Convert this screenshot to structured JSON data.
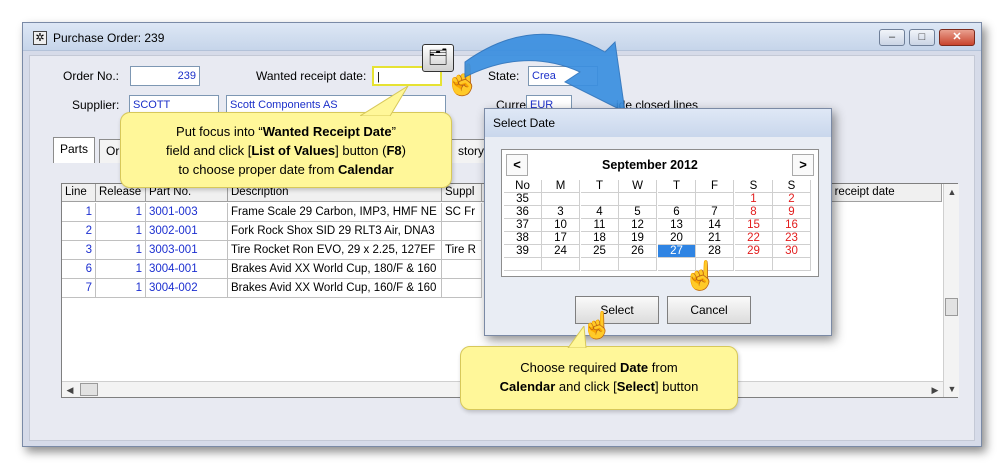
{
  "window": {
    "title": "Purchase Order: 239",
    "min_label": "–",
    "max_label": "□",
    "close_label": "✕"
  },
  "form": {
    "order_no_label": "Order No.:",
    "order_no_value": "239",
    "wanted_receipt_label": "Wanted receipt date:",
    "wanted_receipt_value": "|",
    "state_label": "State:",
    "state_value": "Crea",
    "supplier_label": "Supplier:",
    "supplier_code": "SCOTT",
    "supplier_name": "Scott Components AS",
    "currency_label": "Currency:",
    "currency_value": "EUR",
    "hide_closed_label": "ide closed lines"
  },
  "tabs": [
    "Parts",
    "Or",
    "story"
  ],
  "grid": {
    "headers": [
      "Line",
      "Release",
      "Part No.",
      "Description",
      "Suppl",
      "d receipt date"
    ],
    "rows": [
      {
        "line": "1",
        "release": "1",
        "part": "3001-003",
        "desc": "Frame Scale 29 Carbon, IMP3, HMF NE",
        "supp": "SC Fr"
      },
      {
        "line": "2",
        "release": "1",
        "part": "3002-001",
        "desc": "Fork Rock Shox SID 29 RLT3 Air, DNA3",
        "supp": ""
      },
      {
        "line": "3",
        "release": "1",
        "part": "3003-001",
        "desc": "Tire Rocket Ron EVO, 29 x 2.25, 127EF",
        "supp": "Tire R"
      },
      {
        "line": "6",
        "release": "1",
        "part": "3004-001",
        "desc": "Brakes Avid XX World Cup, 180/F & 160",
        "supp": ""
      },
      {
        "line": "7",
        "release": "1",
        "part": "3004-002",
        "desc": "Brakes Avid XX World Cup, 160/F & 160",
        "supp": ""
      }
    ]
  },
  "dialog": {
    "title": "Select Date",
    "month": "September 2012",
    "prev": "<",
    "next": ">",
    "day_headers": [
      "No",
      "M",
      "T",
      "W",
      "T",
      "F",
      "S",
      "S"
    ],
    "weeks": [
      {
        "no": "35",
        "days": [
          "",
          "",
          "",
          "",
          "",
          "1",
          "2"
        ]
      },
      {
        "no": "36",
        "days": [
          "3",
          "4",
          "5",
          "6",
          "7",
          "8",
          "9"
        ]
      },
      {
        "no": "37",
        "days": [
          "10",
          "11",
          "12",
          "13",
          "14",
          "15",
          "16"
        ]
      },
      {
        "no": "38",
        "days": [
          "17",
          "18",
          "19",
          "20",
          "21",
          "22",
          "23"
        ]
      },
      {
        "no": "39",
        "days": [
          "24",
          "25",
          "26",
          "27",
          "28",
          "29",
          "30"
        ]
      }
    ],
    "selected_day": "27",
    "select_label": "Select",
    "cancel_label": "Cancel"
  },
  "callouts": {
    "top": {
      "line1_a": "Put focus into “",
      "line1_b": "Wanted Receipt Date",
      "line1_c": "”",
      "line2_a": "field and click [",
      "line2_b": "List of Values",
      "line2_c": "] button (",
      "line2_d": "F8",
      "line2_e": ")",
      "line3_a": "to choose proper date from ",
      "line3_b": "Calendar"
    },
    "bottom": {
      "line1_a": "Choose required ",
      "line1_b": "Date",
      "line1_c": " from",
      "line2_a": "Calendar",
      "line2_b": " and click [",
      "line2_c": "Select",
      "line2_d": "] button"
    }
  },
  "colors": {
    "field_text": "#1c2fd0",
    "weekend": "#e21d1d",
    "selected": "#2f84e3",
    "callout": "#fff799",
    "arrow": "#3a8fe0"
  }
}
